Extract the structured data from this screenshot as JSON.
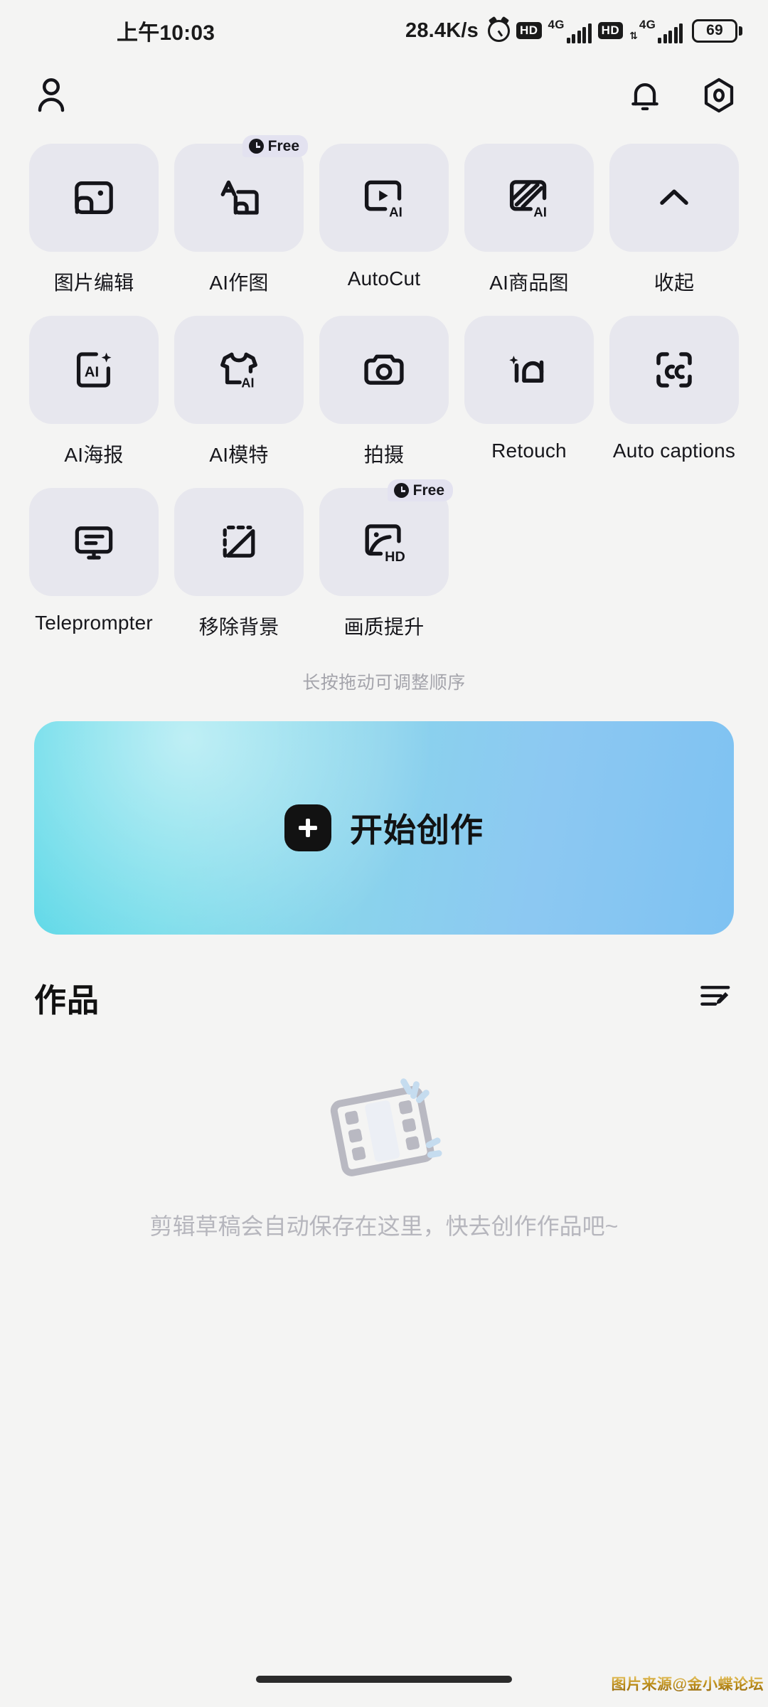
{
  "status_bar": {
    "time": "上午10:03",
    "net_speed": "28.4K/s",
    "alarm_icon": "alarm-clock-icon",
    "sim1_hd": "HD",
    "sim1_network": "4G",
    "sim2_hd": "HD",
    "sim2_network": "4G",
    "battery_level": "69"
  },
  "app_bar": {
    "profile_icon": "person-icon",
    "notification_icon": "bell-icon",
    "settings_icon": "settings-hexagon-icon"
  },
  "tools": {
    "hint": "长按拖动可调整顺序",
    "items": [
      {
        "label": "图片编辑",
        "icon": "image-edit-icon",
        "badge": ""
      },
      {
        "label": "AI作图",
        "icon": "ai-text-to-image-icon",
        "badge": "Free"
      },
      {
        "label": "AutoCut",
        "icon": "autocut-ai-icon",
        "badge": ""
      },
      {
        "label": "AI商品图",
        "icon": "ai-product-image-icon",
        "badge": ""
      },
      {
        "label": "收起",
        "icon": "chevron-up-icon",
        "badge": ""
      },
      {
        "label": "AI海报",
        "icon": "ai-poster-icon",
        "badge": ""
      },
      {
        "label": "AI模特",
        "icon": "ai-model-tshirt-icon",
        "badge": ""
      },
      {
        "label": "拍摄",
        "icon": "camera-icon",
        "badge": ""
      },
      {
        "label": "Retouch",
        "icon": "retouch-face-icon",
        "badge": ""
      },
      {
        "label": "Auto captions",
        "icon": "closed-captions-icon",
        "badge": ""
      },
      {
        "label": "Teleprompter",
        "icon": "teleprompter-icon",
        "badge": ""
      },
      {
        "label": "移除背景",
        "icon": "remove-background-icon",
        "badge": ""
      },
      {
        "label": "画质提升",
        "icon": "hd-enhance-icon",
        "badge": "Free"
      }
    ]
  },
  "cta": {
    "label": "开始创作",
    "plus_icon": "plus-icon",
    "gradient_from": "#5ed9e8",
    "gradient_to": "#7ec2f2"
  },
  "works": {
    "title": "作品",
    "manage_icon": "list-edit-icon",
    "empty_illustration": "film-strip-icon",
    "empty_text": "剪辑草稿会自动保存在这里，快去创作作品吧~"
  },
  "footer": {
    "watermark": "图片来源@金小蝶论坛",
    "home_indicator": "home-indicator"
  }
}
